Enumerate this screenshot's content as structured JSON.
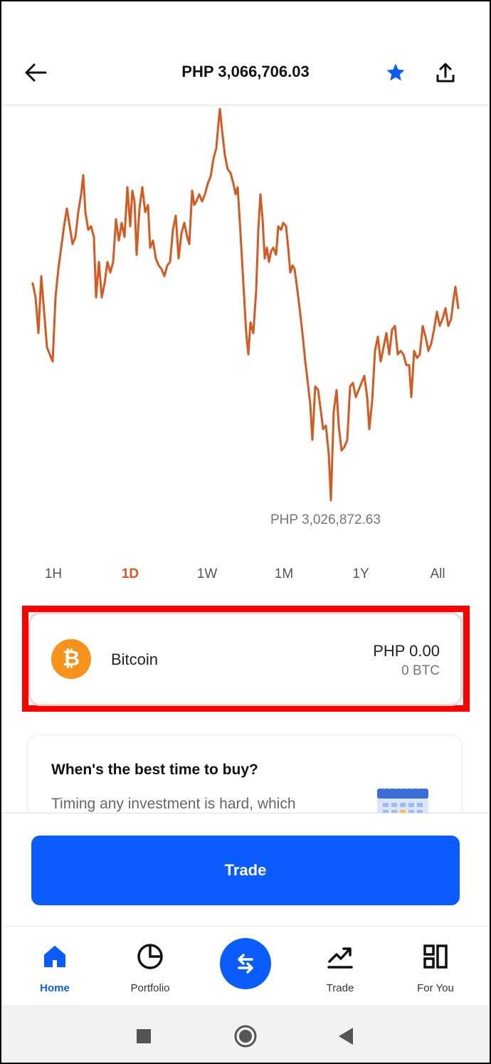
{
  "header": {
    "title": "PHP 3,066,706.03"
  },
  "icons": {
    "back": "back-arrow-icon",
    "star": "star-icon",
    "share": "share-icon"
  },
  "colors": {
    "accent": "#0a5cff",
    "chart_line": "#d65a1f",
    "bitcoin": "#f7931a",
    "highlight": "#ff0000"
  },
  "chart": {
    "low_label": "PHP 3,026,872.63",
    "type": "line"
  },
  "tabs": [
    {
      "label": "1H",
      "active": false
    },
    {
      "label": "1D",
      "active": true
    },
    {
      "label": "1W",
      "active": false
    },
    {
      "label": "1M",
      "active": false
    },
    {
      "label": "1Y",
      "active": false
    },
    {
      "label": "All",
      "active": false
    }
  ],
  "asset": {
    "symbol_glyph": "₿",
    "name": "Bitcoin",
    "value": "PHP 0.00",
    "amount": "0 BTC"
  },
  "info_card": {
    "title": "When's the best time to buy?",
    "body": "Timing any investment is hard, which"
  },
  "trade_button": {
    "label": "Trade"
  },
  "bottom_nav": {
    "home": "Home",
    "portfolio": "Portfolio",
    "trade": "Trade",
    "for_you": "For You"
  }
}
